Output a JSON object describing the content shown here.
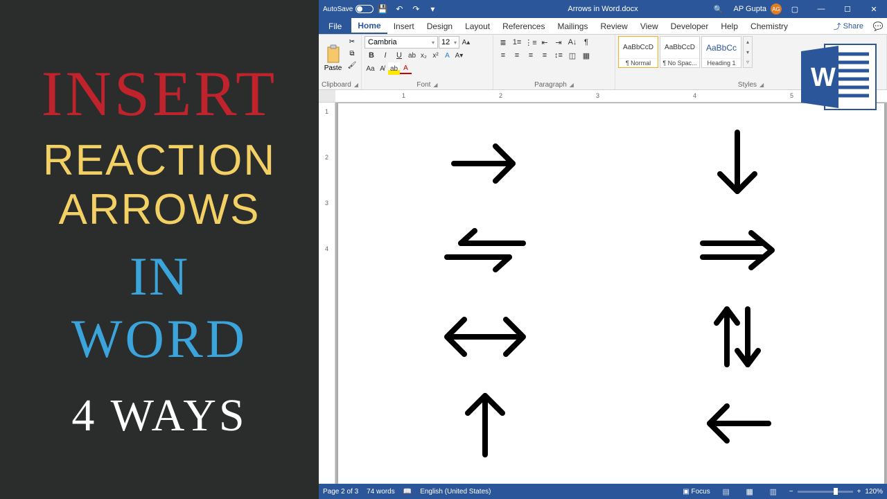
{
  "promo": {
    "l1": "INSERT",
    "l2": "REACTION",
    "l3": "ARROWS",
    "l4": "IN",
    "l5": "WORD",
    "l6": "4 WAYS"
  },
  "titlebar": {
    "autosave": "AutoSave",
    "autosave_state": "Off",
    "doc_title": "Arrows in Word.docx",
    "user": "AP Gupta",
    "user_initials": "AG"
  },
  "tabs": [
    "File",
    "Home",
    "Insert",
    "Design",
    "Layout",
    "References",
    "Mailings",
    "Review",
    "View",
    "Developer",
    "Help",
    "Chemistry"
  ],
  "active_tab": "Home",
  "share": "Share",
  "ribbon": {
    "clipboard_label": "Clipboard",
    "paste": "Paste",
    "font_label": "Font",
    "font_name": "Cambria",
    "font_size": "12",
    "para_label": "Paragraph",
    "styles_label": "Styles",
    "styles": [
      {
        "sample": "AaBbCcD",
        "name": "¶ Normal"
      },
      {
        "sample": "AaBbCcD",
        "name": "¶ No Spac..."
      },
      {
        "sample": "AaBbCc",
        "name": "Heading 1"
      }
    ]
  },
  "ruler": [
    "1",
    "2",
    "3",
    "4",
    "5"
  ],
  "vruler": [
    "1",
    "2",
    "3",
    "4"
  ],
  "arrows": [
    "right",
    "down",
    "equilibrium",
    "double-right",
    "leftright",
    "updown",
    "up",
    "left"
  ],
  "status": {
    "page": "Page 2 of 3",
    "words": "74 words",
    "lang": "English (United States)",
    "focus": "Focus",
    "zoom": "120%"
  }
}
